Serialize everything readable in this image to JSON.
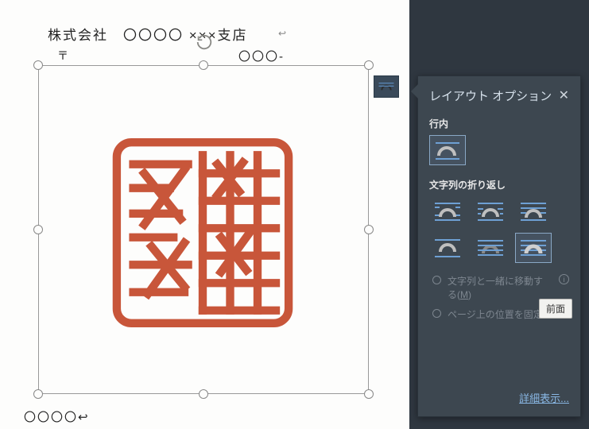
{
  "doc": {
    "line1": "株式会社　〇〇〇〇 ×××支店",
    "line1_mark": "↩",
    "line2_postal": "〒",
    "line2_right": "〇〇〇-",
    "bottom": "〇〇〇〇↩"
  },
  "flyout": {
    "title": "レイアウト オプション",
    "section_inline": "行内",
    "section_wrap": "文字列の折り返し",
    "radio_move_with_text": "文字列と一緒に移動する(",
    "radio_move_with_text_key": "M",
    "radio_move_with_text_suffix": ")",
    "radio_fix_position": "ページ上の位置を固定",
    "tooltip_front": "前面",
    "see_more": "詳細表示..."
  },
  "icons": {
    "close": "✕"
  }
}
